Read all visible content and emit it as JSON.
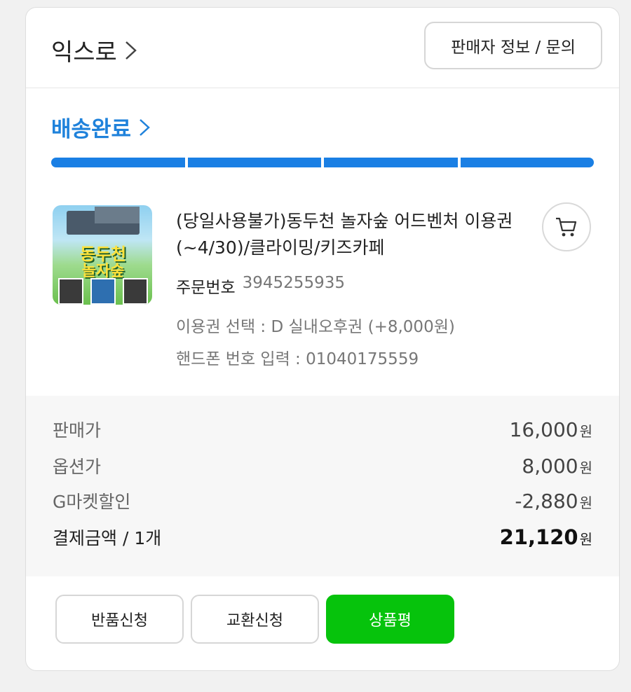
{
  "seller": {
    "name": "익스로",
    "info_button": "판매자 정보 / 문의"
  },
  "status": {
    "label": "배송완료",
    "progress_steps": 4,
    "progress_completed": 4,
    "color": "#1a7fe4"
  },
  "product": {
    "thumbnail": {
      "line1": "동두천",
      "line2": "놀자숲"
    },
    "title": "(당일사용불가)동두천 놀자숲 어드벤처 이용권(~4/30)/클라이밍/키즈카페",
    "order_label": "주문번호",
    "order_number": "3945255935",
    "options": [
      "이용권 선택 : D 실내오후권 (+8,000원)",
      "핸드폰 번호 입력 : 01040175559"
    ]
  },
  "prices": [
    {
      "label": "판매가",
      "value": "16,000",
      "unit": "원"
    },
    {
      "label": "옵션가",
      "value": "8,000",
      "unit": "원"
    },
    {
      "label": "G마켓할인",
      "value": "-2,880",
      "unit": "원"
    }
  ],
  "total": {
    "label": "결제금액 / 1개",
    "value": "21,120",
    "unit": "원"
  },
  "actions": {
    "return": "반품신청",
    "exchange": "교환신청",
    "review": "상품평"
  },
  "colors": {
    "accent_blue": "#1f82db",
    "review_green": "#06c30c"
  }
}
